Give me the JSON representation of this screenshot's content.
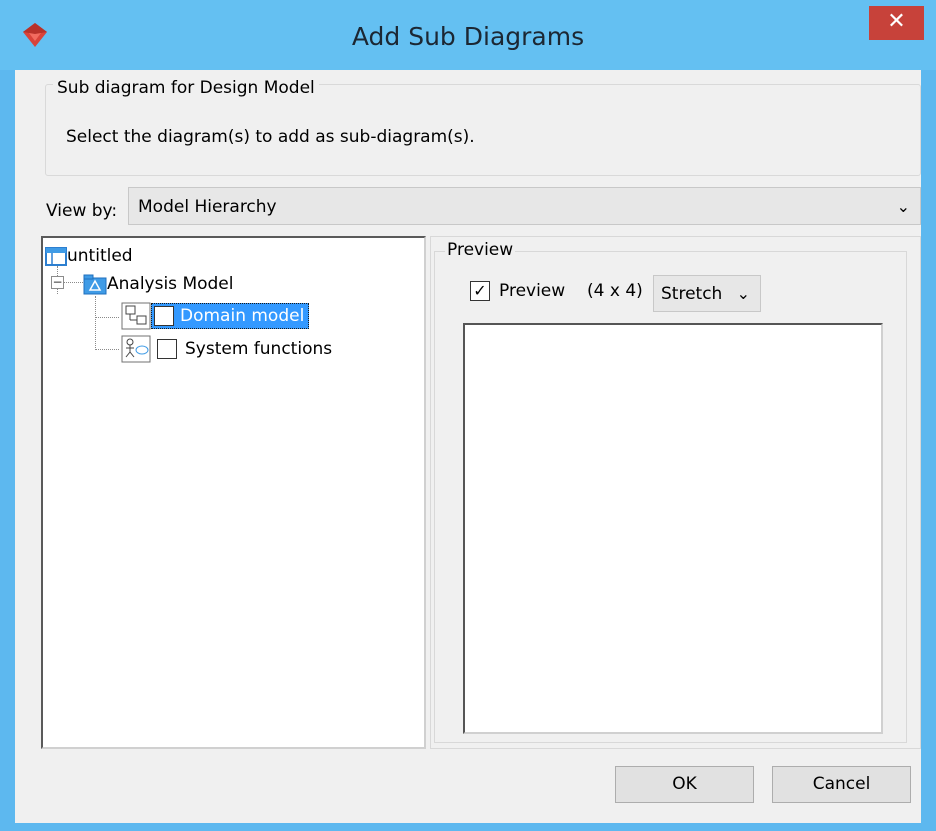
{
  "window": {
    "title": "Add Sub Diagrams",
    "close_glyph": "✕"
  },
  "group": {
    "legend": "Sub diagram for Design Model",
    "description": "Select the diagram(s) to add as sub-diagram(s)."
  },
  "view_by": {
    "label": "View by:",
    "selected": "Model Hierarchy"
  },
  "tree": {
    "root": {
      "label": "untitled",
      "icon": "project-icon"
    },
    "model": {
      "label": "Analysis Model",
      "icon": "model-package-icon",
      "expanded": true
    },
    "items": [
      {
        "label": "Domain model",
        "icon": "class-diagram-icon",
        "checked": true,
        "selected": true
      },
      {
        "label": "System functions",
        "icon": "use-case-diagram-icon",
        "checked": false,
        "selected": false
      }
    ]
  },
  "preview": {
    "legend": "Preview",
    "checkbox_label": "Preview",
    "checked": true,
    "size_text": "(4 x 4)",
    "mode_selected": "Stretch"
  },
  "buttons": {
    "ok": "OK",
    "cancel": "Cancel"
  },
  "colors": {
    "titlebar": "#64c0f2",
    "close": "#c7423a",
    "selection": "#3399ff"
  }
}
